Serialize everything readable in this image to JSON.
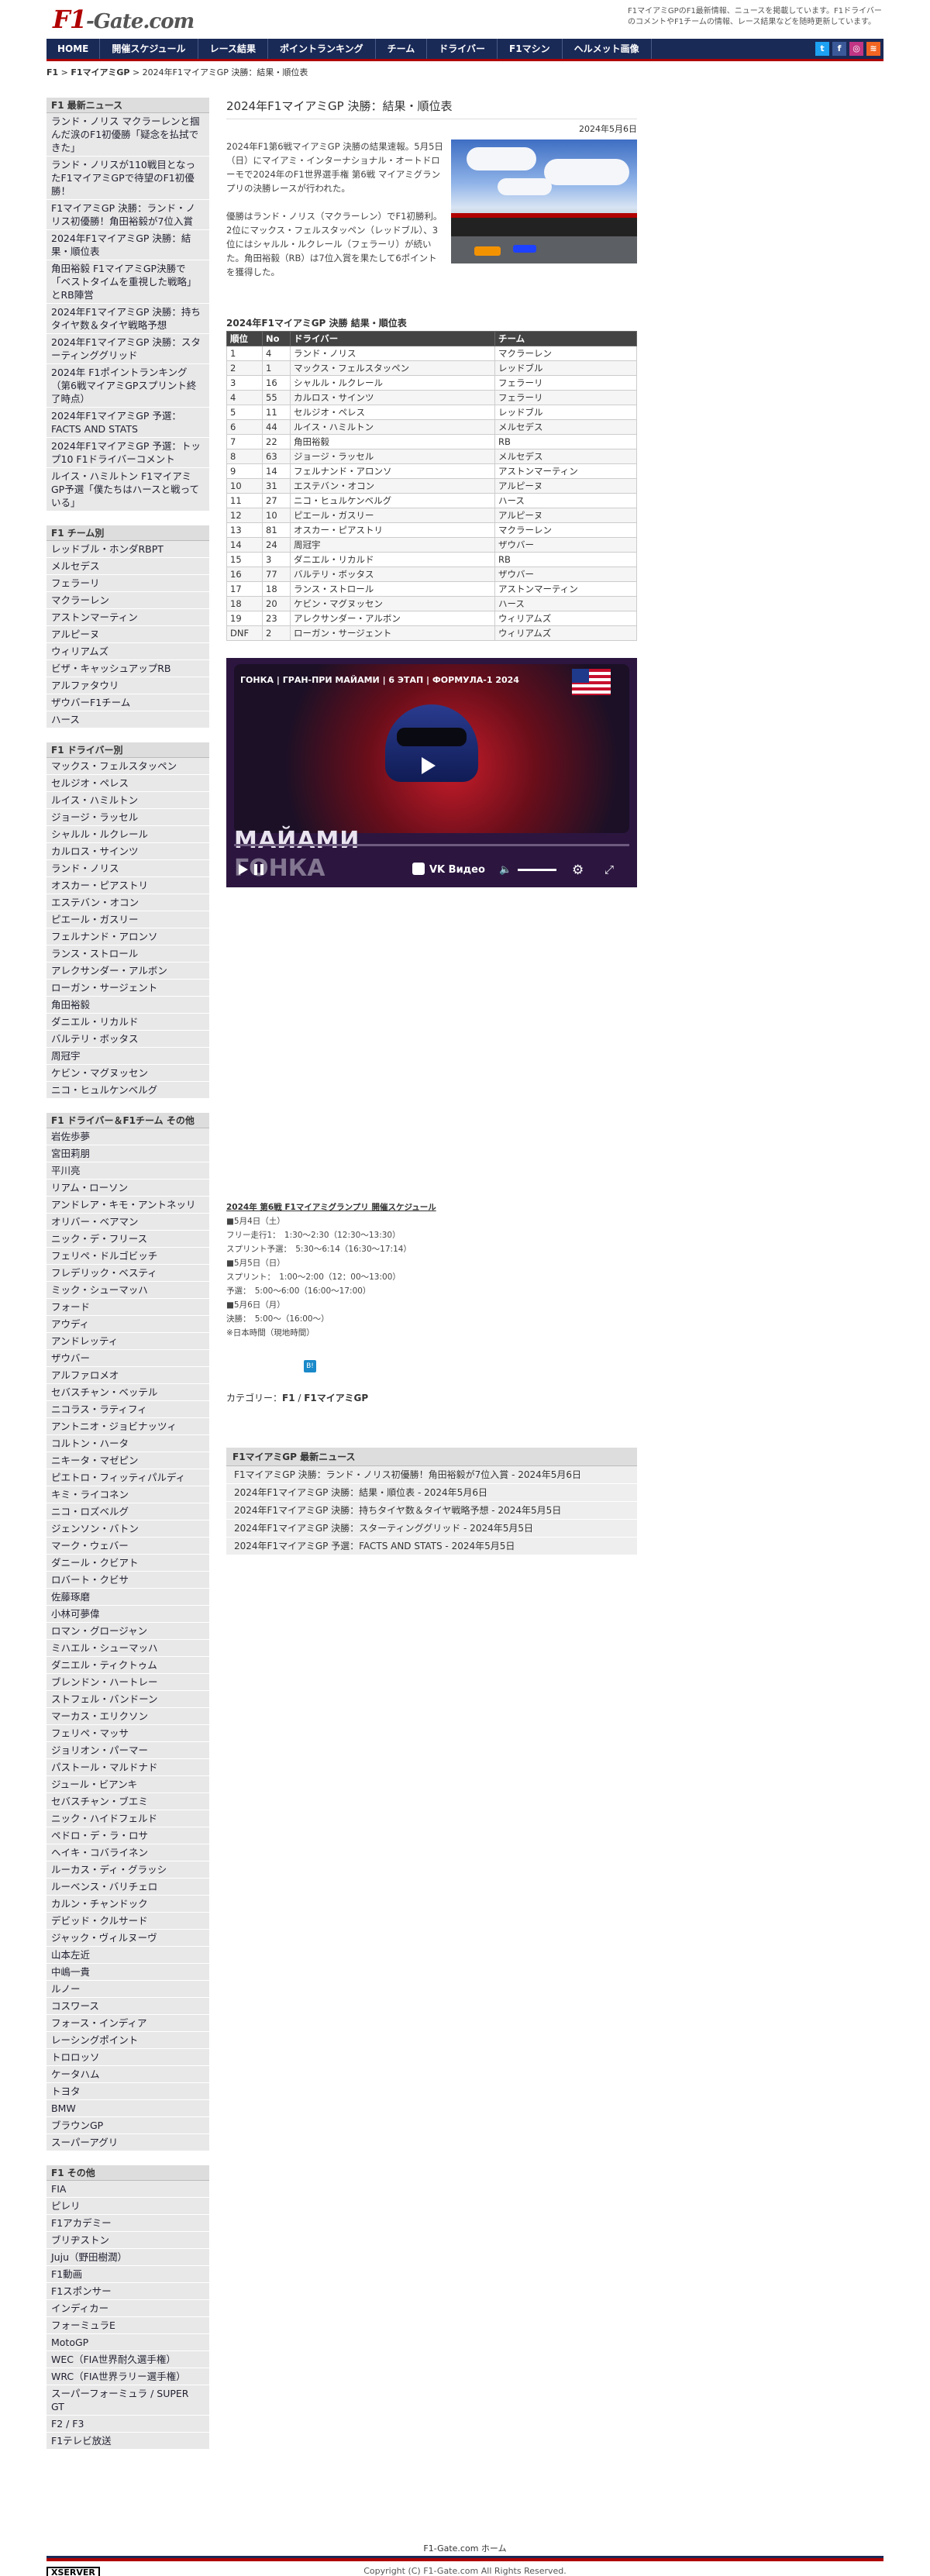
{
  "header": {
    "logo_main": "F1",
    "logo_sep": "-",
    "logo_rest": "Gate.com",
    "tagline": "F1マイアミGPのF1最新情報、ニュースを掲載しています。F1ドライバーのコメントやF1チームの情報、レース結果などを随時更新しています。"
  },
  "nav": {
    "items": [
      "HOME",
      "開催スケジュール",
      "レース結果",
      "ポイントランキング",
      "チーム",
      "ドライバー",
      "F1マシン",
      "ヘルメット画像"
    ],
    "social_colors": {
      "twitter": "#1da1f2",
      "facebook": "#3b5998",
      "instagram": "#c13584",
      "rss": "#f26522"
    }
  },
  "breadcrumb": {
    "home": "F1",
    "sep1": ">",
    "category": "F1マイアミGP",
    "sep2": ">",
    "current": "2024年F1マイアミGP 決勝：結果・順位表"
  },
  "sidebar": {
    "news": {
      "title": "F1 最新ニュース",
      "items": [
        "ランド・ノリス マクラーレンと掴んだ涙のF1初優勝「疑念を払拭できた」",
        "ランド・ノリスが110戦目となったF1マイアミGPで待望のF1初優勝！",
        "F1マイアミGP 決勝：ランド・ノリス初優勝！角田裕毅が7位入賞",
        "2024年F1マイアミGP 決勝：結果・順位表",
        "角田裕毅 F1マイアミGP決勝で「ベストタイムを重視した戦略」とRB陣営",
        "2024年F1マイアミGP 決勝：持ちタイヤ数＆タイヤ戦略予想",
        "2024年F1マイアミGP 決勝：スターティンググリッド",
        "2024年 F1ポイントランキング（第6戦マイアミGPスプリント終了時点）",
        "2024年F1マイアミGP 予選：FACTS AND STATS",
        "2024年F1マイアミGP 予選：トップ10 F1ドライバーコメント",
        "ルイス・ハミルトン F1マイアミGP予選「僕たちはハースと戦っている」"
      ]
    },
    "teams": {
      "title": "F1 チーム別",
      "items": [
        "レッドブル・ホンダRBPT",
        "メルセデス",
        "フェラーリ",
        "マクラーレン",
        "アストンマーティン",
        "アルピーヌ",
        "ウィリアムズ",
        "ビザ・キャッシュアップRB",
        "アルファタウリ",
        "ザウバーF1チーム",
        "ハース"
      ]
    },
    "drivers": {
      "title": "F1 ドライバー別",
      "items": [
        "マックス・フェルスタッペン",
        "セルジオ・ペレス",
        "ルイス・ハミルトン",
        "ジョージ・ラッセル",
        "シャルル・ルクレール",
        "カルロス・サインツ",
        "ランド・ノリス",
        "オスカー・ピアストリ",
        "エステバン・オコン",
        "ピエール・ガスリー",
        "フェルナンド・アロンソ",
        "ランス・ストロール",
        "アレクサンダー・アルボン",
        "ローガン・サージェント",
        "角田裕毅",
        "ダニエル・リカルド",
        "バルテリ・ボッタス",
        "周冠宇",
        "ケビン・マグヌッセン",
        "ニコ・ヒュルケンベルグ"
      ]
    },
    "others": {
      "title": "F1 ドライバー＆F1チーム その他",
      "items": [
        "岩佐歩夢",
        "宮田莉朋",
        "平川亮",
        "リアム・ローソン",
        "アンドレア・キモ・アントネッリ",
        "オリバー・ベアマン",
        "ニック・デ・フリース",
        "フェリペ・ドルゴビッチ",
        "フレデリック・ベスティ",
        "ミック・シューマッハ",
        "フォード",
        "アウディ",
        "アンドレッティ",
        "ザウバー",
        "アルファロメオ",
        "セバスチャン・ベッテル",
        "ニコラス・ラティフィ",
        "アントニオ・ジョビナッツィ",
        "コルトン・ハータ",
        "ニキータ・マゼピン",
        "ピエトロ・フィッティパルディ",
        "キミ・ライコネン",
        "ニコ・ロズベルグ",
        "ジェンソン・バトン",
        "マーク・ウェバー",
        "ダニール・クビアト",
        "ロバート・クビサ",
        "佐藤琢磨",
        "小林可夢偉",
        "ロマン・グロージャン",
        "ミハエル・シューマッハ",
        "ダニエル・ティクトゥム",
        "ブレンドン・ハートレー",
        "ストフェル・バンドーン",
        "マーカス・エリクソン",
        "フェリペ・マッサ",
        "ジョリオン・パーマー",
        "パストール・マルドナド",
        "ジュール・ビアンキ",
        "セバスチャン・ブエミ",
        "ニック・ハイドフェルド",
        "ペドロ・デ・ラ・ロサ",
        "ヘイキ・コバライネン",
        "ルーカス・ディ・グラッシ",
        "ルーベンス・バリチェロ",
        "カルン・チャンドック",
        "デビッド・クルサード",
        "ジャック・ヴィルヌーヴ",
        "山本左近",
        "中嶋一貴",
        "ルノー",
        "コスワース",
        "フォース・インディア",
        "レーシングポイント",
        "トロロッソ",
        "ケータハム",
        "トヨタ",
        "BMW",
        "ブラウンGP",
        "スーパーアグリ"
      ]
    },
    "misc": {
      "title": "F1 その他",
      "items": [
        "FIA",
        "ピレリ",
        "F1アカデミー",
        "ブリヂストン",
        "Juju（野田樹潤）",
        "F1動画",
        "F1スポンサー",
        "インディカー",
        "フォーミュラE",
        "MotoGP",
        "WEC（FIA世界耐久選手権）",
        "WRC（FIA世界ラリー選手権）",
        "スーパーフォーミュラ / SUPER GT",
        "F2 / F3",
        "F1テレビ放送"
      ]
    }
  },
  "article": {
    "title": "2024年F1マイアミGP 決勝：結果・順位表",
    "date": "2024年5月6日",
    "para1": "2024年F1第6戦マイアミGP 決勝の結果速報。5月5日（日）にマイアミ・インターナショナル・オートドローモで2024年のF1世界選手権 第6戦 マイアミグランプリの決勝レースが行われた。",
    "para2": "優勝はランド・ノリス（マクラーレン）でF1初勝利。2位にマックス・フェルスタッペン（レッドブル）、3位にはシャルル・ルクレール（フェラーリ）が続いた。角田裕毅（RB）は7位入賞を果たして6ポイントを獲得した。",
    "results_title": "2024年F1マイアミGP 決勝 結果・順位表",
    "table_headers": [
      "順位",
      "No",
      "ドライバー",
      "チーム"
    ],
    "results": [
      [
        "1",
        "4",
        "ランド・ノリス",
        "マクラーレン"
      ],
      [
        "2",
        "1",
        "マックス・フェルスタッペン",
        "レッドブル"
      ],
      [
        "3",
        "16",
        "シャルル・ルクレール",
        "フェラーリ"
      ],
      [
        "4",
        "55",
        "カルロス・サインツ",
        "フェラーリ"
      ],
      [
        "5",
        "11",
        "セルジオ・ペレス",
        "レッドブル"
      ],
      [
        "6",
        "44",
        "ルイス・ハミルトン",
        "メルセデス"
      ],
      [
        "7",
        "22",
        "角田裕毅",
        "RB"
      ],
      [
        "8",
        "63",
        "ジョージ・ラッセル",
        "メルセデス"
      ],
      [
        "9",
        "14",
        "フェルナンド・アロンソ",
        "アストンマーティン"
      ],
      [
        "10",
        "31",
        "エステバン・オコン",
        "アルピーヌ"
      ],
      [
        "11",
        "27",
        "ニコ・ヒュルケンベルグ",
        "ハース"
      ],
      [
        "12",
        "10",
        "ピエール・ガスリー",
        "アルピーヌ"
      ],
      [
        "13",
        "81",
        "オスカー・ピアストリ",
        "マクラーレン"
      ],
      [
        "14",
        "24",
        "周冠宇",
        "ザウバー"
      ],
      [
        "15",
        "3",
        "ダニエル・リカルド",
        "RB"
      ],
      [
        "16",
        "77",
        "バルテリ・ボッタス",
        "ザウバー"
      ],
      [
        "17",
        "18",
        "ランス・ストロール",
        "アストンマーティン"
      ],
      [
        "18",
        "20",
        "ケビン・マグヌッセン",
        "ハース"
      ],
      [
        "19",
        "23",
        "アレクサンダー・アルボン",
        "ウィリアムズ"
      ],
      [
        "DNF",
        "2",
        "ローガン・サージェント",
        "ウィリアムズ"
      ]
    ]
  },
  "video": {
    "title": "ГОНКА | ГРАН-ПРИ МАЙАМИ | 6 ЭТАП | ФОРМУЛА-1 2024",
    "overlay1": "МАЙАМИ",
    "overlay2": "ГОНКА",
    "brand": "VK Видео"
  },
  "schedule": {
    "title": "2024年 第6戦 F1マイアミグランプリ 開催スケジュール",
    "lines": [
      "■5月4日（土）",
      "フリー走行1：　1:30〜2:30（12:30〜13:30）",
      "スプリント予選：　5:30〜6:14（16:30〜17:14）",
      "■5月5日（日）",
      "スプリント：　1:00〜2:00（12：00〜13:00）",
      "予選：　5:00〜6:00（16:00〜17:00）",
      "■5月6日（月）",
      "決勝：　5:00〜（16:00〜）",
      "※日本時間（現地時間）"
    ]
  },
  "tag_icon_label": "B!",
  "category": {
    "label": "カテゴリー：",
    "a": "F1",
    "sep": " / ",
    "b": "F1マイアミGP"
  },
  "related": {
    "title": "F1マイアミGP 最新ニュース",
    "items": [
      "F1マイアミGP 決勝：ランド・ノリス初優勝！角田裕毅が7位入賞 - 2024年5月6日",
      "2024年F1マイアミGP 決勝：結果・順位表 - 2024年5月6日",
      "2024年F1マイアミGP 決勝：持ちタイヤ数＆タイヤ戦略予想 - 2024年5月5日",
      "2024年F1マイアミGP 決勝：スターティンググリッド - 2024年5月5日",
      "2024年F1マイアミGP 予選：FACTS AND STATS - 2024年5月5日"
    ]
  },
  "footer": {
    "home": "F1-Gate.com ホーム",
    "copyright": "Copyright (C) F1-Gate.com All Rights Reserved.",
    "host": "XSERVER"
  }
}
